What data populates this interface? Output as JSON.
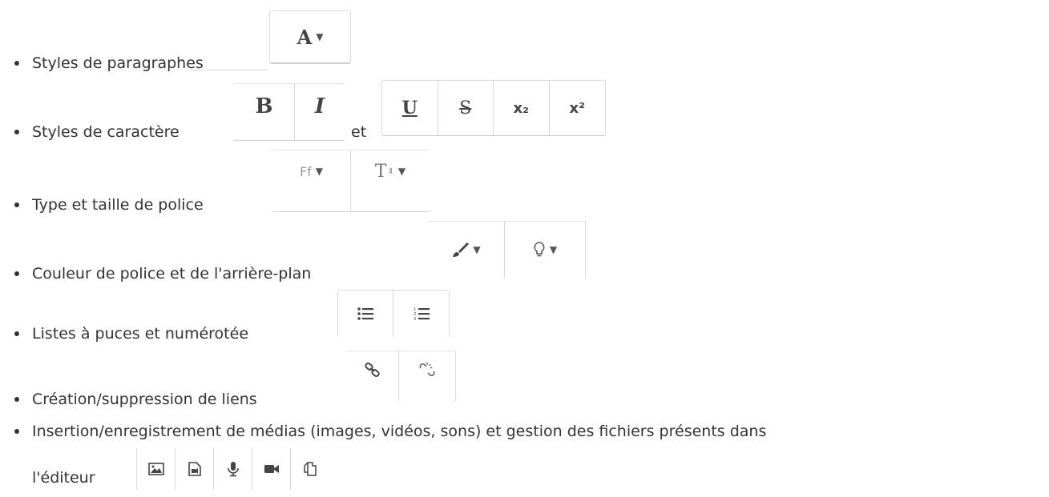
{
  "items": [
    {
      "label": "Styles de paragraphes"
    },
    {
      "label": "Styles de caractère",
      "connector": "et"
    },
    {
      "label": "Type et taille de police"
    },
    {
      "label": "Couleur de police et de l'arrière-plan"
    },
    {
      "label": "Listes à puces et numérotée"
    },
    {
      "label": "Création/suppression de liens"
    },
    {
      "label": "Insertion/enregistrement de médias (images, vidéos, sons) et gestion des fichiers présents dans",
      "continuation": "l'éditeur"
    }
  ],
  "toolbars": {
    "paragraph": {
      "glyph": "A",
      "icon": "paragraph-style-icon"
    },
    "char_basic": {
      "bold": "B",
      "italic": "I"
    },
    "char_extra": {
      "underline": "U",
      "strike": "S",
      "sub": "x₂",
      "sup": "x²"
    },
    "font": {
      "family_glyph": "Ff",
      "size_glyph": "T"
    }
  },
  "colors": {
    "text": "#333333",
    "border": "#d8d8d8",
    "icon": "#444444"
  }
}
